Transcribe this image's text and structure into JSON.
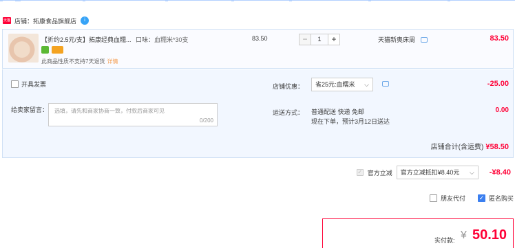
{
  "shop": {
    "tag": "天猫",
    "name": "店铺：拓康食品旗舰店",
    "badge": "i"
  },
  "item": {
    "title": "【折约2.5元/支】拓康经典血糯...",
    "sku": "口味：血糯米*30支",
    "note": "此商品性质不支持7天退货",
    "note_link": "详情",
    "unit_price": "83.50",
    "qty_minus": "−",
    "qty": "1",
    "qty_plus": "+",
    "ship_type": "天猫新奥床周",
    "subtotal": "83.50"
  },
  "order": {
    "invoice_label": "开具发票",
    "message_label": "给卖家留言：",
    "message_placeholder": "选填，请先和商家协商一致，付款后商家可见",
    "message_count": "0/200",
    "coupon_label": "店铺优惠：",
    "coupon_value": "省25元:血糯米",
    "coupon_arrow": "⌵",
    "coupon_amount": "-25.00",
    "ship_label": "运送方式：",
    "ship_line1": "普通配送 快递 免邮",
    "ship_line2": "现在下单，预计3月12日送达",
    "ship_fee": "0.00",
    "store_total_label": "店铺合计(含运费)",
    "store_total": "¥58.50"
  },
  "tmall": {
    "check_mark": "✓",
    "label": "官方立减",
    "select_value": "官方立减抵扣¥8.40元",
    "select_arrow": "⌵",
    "amount": "-¥8.40"
  },
  "options": {
    "friend_pay": "朋友代付",
    "anonymous": "匿名购买",
    "anonymous_check": "✓"
  },
  "payment": {
    "label": "实付款:",
    "currency": "¥",
    "amount": "50.10"
  },
  "colors": {
    "accent": "#ff0036",
    "border_blue": "#cfe0f5",
    "panel_bg": "#f2f7ff"
  }
}
